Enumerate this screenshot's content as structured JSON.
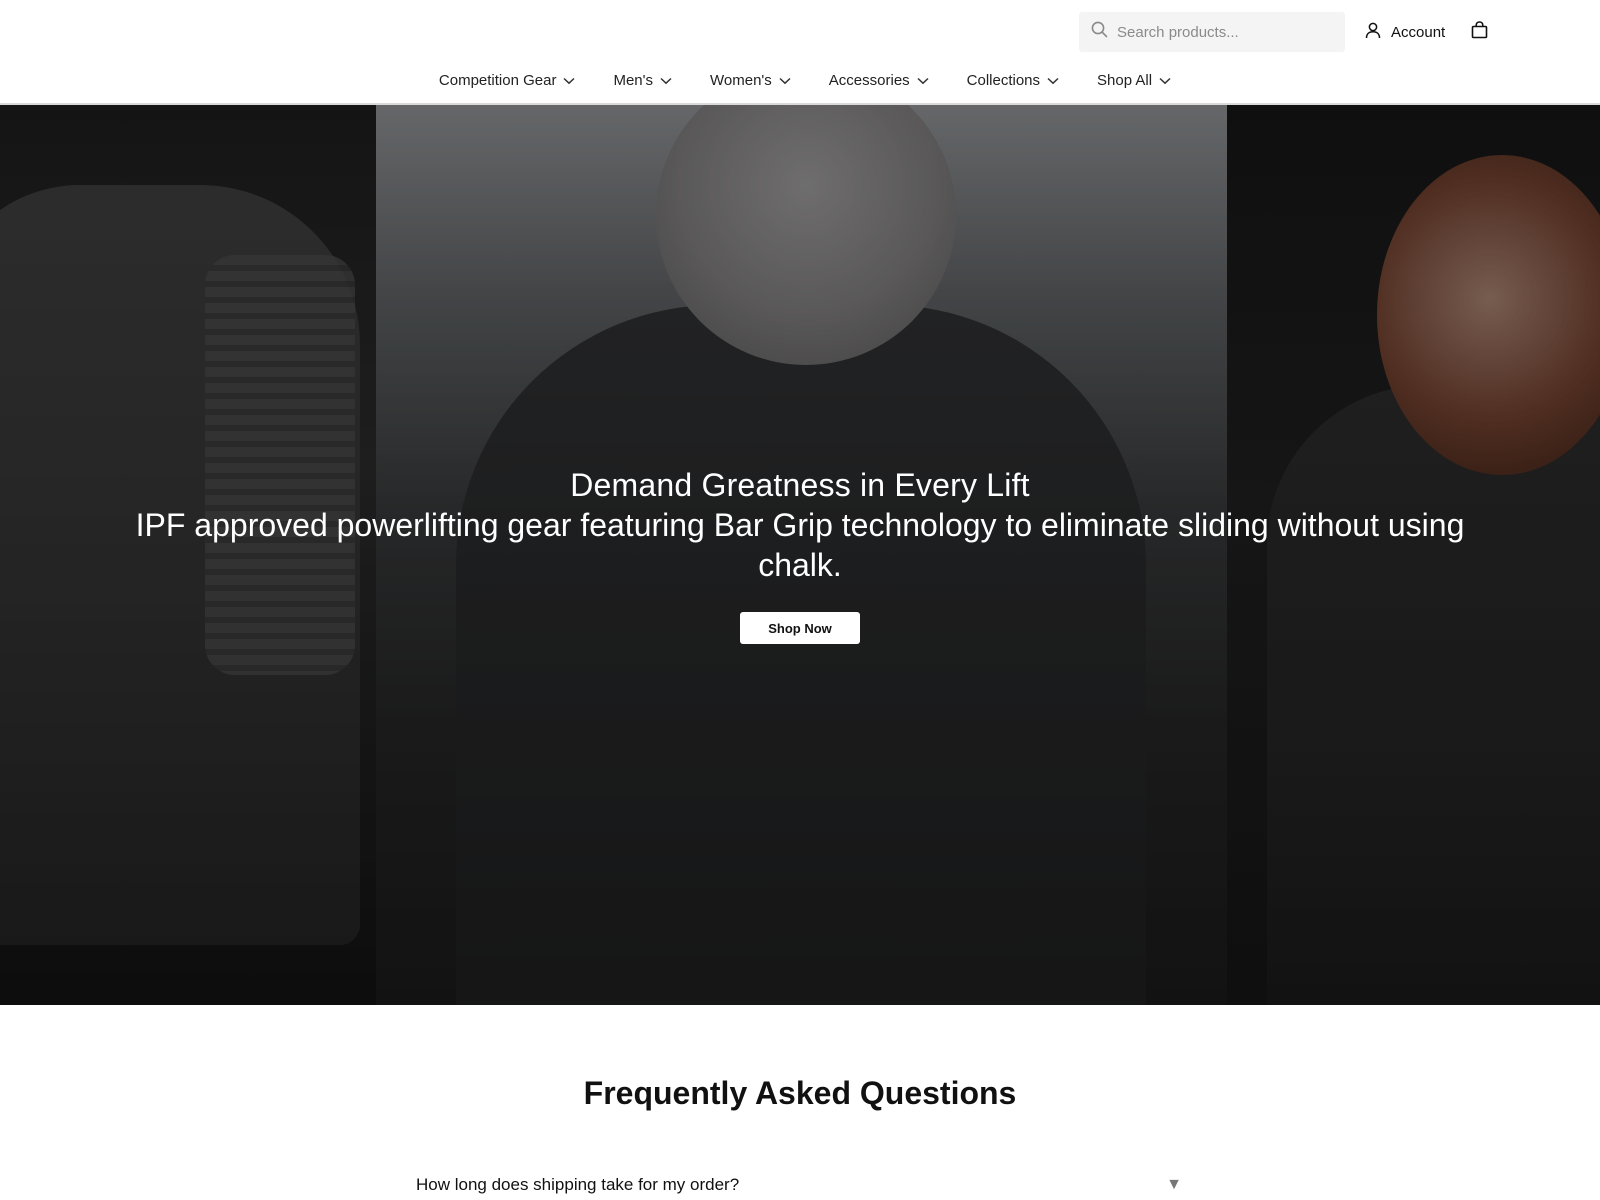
{
  "header": {
    "search": {
      "placeholder": "Search products..."
    },
    "account_label": "Account",
    "nav": [
      {
        "label": "Competition Gear"
      },
      {
        "label": "Men's"
      },
      {
        "label": "Women's"
      },
      {
        "label": "Accessories"
      },
      {
        "label": "Collections"
      },
      {
        "label": "Shop All"
      }
    ]
  },
  "hero": {
    "title": "Demand Greatness in Every Lift",
    "subtitle": "IPF approved powerlifting gear featuring Bar Grip technology to eliminate sliding without using chalk.",
    "cta_label": "Shop Now"
  },
  "faq": {
    "title": "Frequently Asked Questions",
    "items": [
      {
        "question": "How long does shipping take for my order?",
        "toggle": "▼"
      }
    ]
  },
  "icons": {
    "search": "search-icon",
    "account": "user-icon",
    "cart": "shopping-bag-icon",
    "nav_dropdown": "chevron-down-icon"
  }
}
